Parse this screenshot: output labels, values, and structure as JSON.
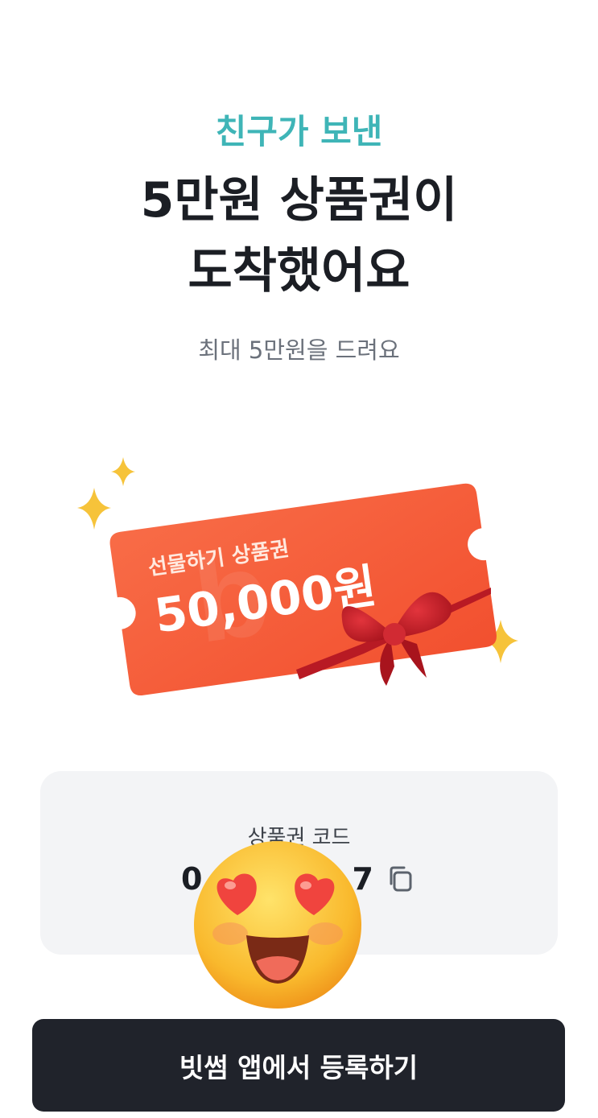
{
  "header": {
    "eyebrow": "친구가 보낸",
    "headline_line1": "5만원 상품권이",
    "headline_line2": "도착했어요",
    "subtitle": "최대 5만원을 드려요"
  },
  "ticket": {
    "label": "선물하기 상품권",
    "amount": "50,000원",
    "color": "#f5603c",
    "ribbon_color": "#c8202a"
  },
  "code_card": {
    "label": "상품권 코드",
    "value_prefix": "0",
    "value_suffix": "7",
    "copy_icon": "copy-icon"
  },
  "overlay": {
    "emoji": "heart-eyes-emoji"
  },
  "cta": {
    "label": "빗썸 앱에서 등록하기"
  },
  "colors": {
    "accent": "#3fb5b7",
    "text_primary": "#1b1e24",
    "button_bg": "#20232b"
  }
}
